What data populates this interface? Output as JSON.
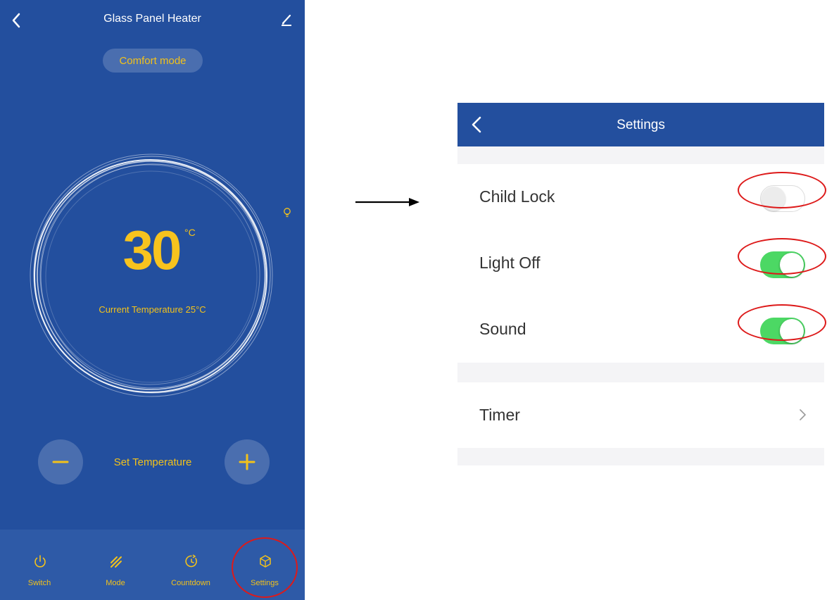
{
  "heater": {
    "title": "Glass Panel Heater",
    "mode": "Comfort mode",
    "set_temperature": "30",
    "unit": "°C",
    "current_temperature": "Current Temperature 25°C",
    "set_label": "Set Temperature",
    "accent_color": "#f3c21a",
    "background_color": "#234f9e",
    "nav": [
      {
        "label": "Switch",
        "icon": "power-icon"
      },
      {
        "label": "Mode",
        "icon": "mode-icon"
      },
      {
        "label": "Countdown",
        "icon": "countdown-icon"
      },
      {
        "label": "Settings",
        "icon": "settings-icon"
      }
    ]
  },
  "settings": {
    "title": "Settings",
    "rows": [
      {
        "label": "Child Lock",
        "state": "off"
      },
      {
        "label": "Light Off",
        "state": "on"
      },
      {
        "label": "Sound",
        "state": "on"
      }
    ],
    "timer_label": "Timer",
    "toggle_on_color": "#4cd864",
    "highlight_color": "#dd1a1a"
  }
}
